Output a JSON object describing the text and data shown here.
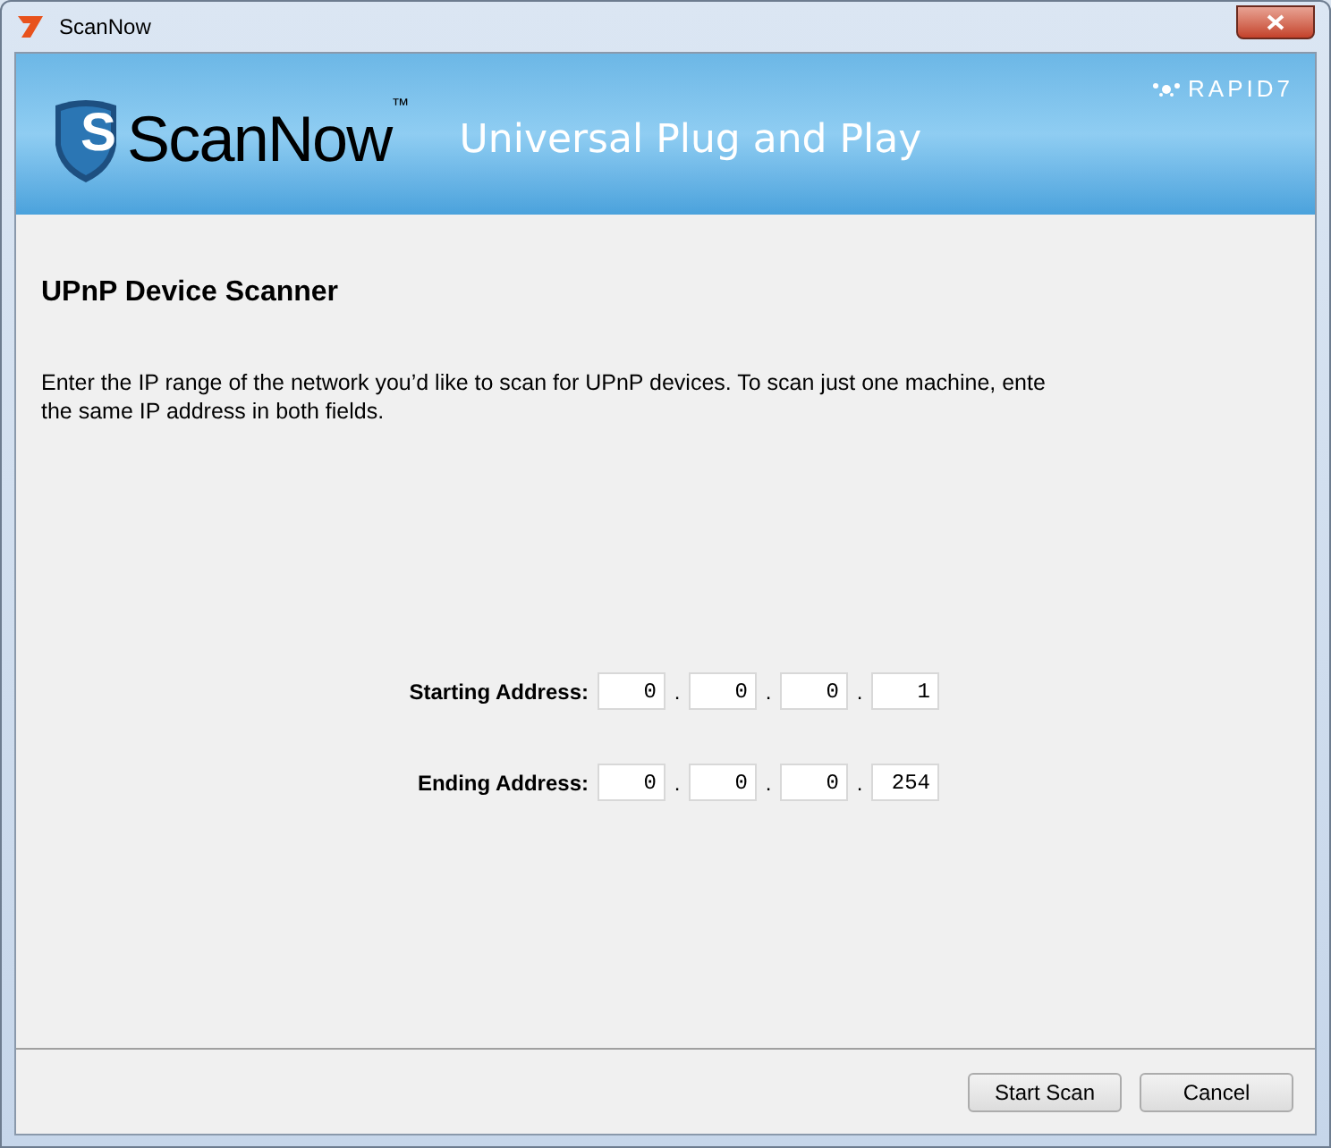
{
  "window": {
    "title": "ScanNow"
  },
  "banner": {
    "product": "ScanNow",
    "trademark": "™",
    "logo_letter": "S",
    "subtitle": "Universal Plug and Play",
    "brand": "RAPID7"
  },
  "heading": "UPnP Device Scanner",
  "description": [
    "Enter the IP range of the network you’d like to scan for UPnP devices. To scan just one machine, ente",
    "the same IP address in both fields."
  ],
  "addresses": [
    {
      "label": "Starting Address:",
      "octets": [
        "0",
        "0",
        "0",
        "1"
      ]
    },
    {
      "label": "Ending Address:",
      "octets": [
        "0",
        "0",
        "0",
        "254"
      ]
    }
  ],
  "separator": ".",
  "buttons": [
    {
      "label": "Start Scan"
    },
    {
      "label": "Cancel"
    }
  ]
}
